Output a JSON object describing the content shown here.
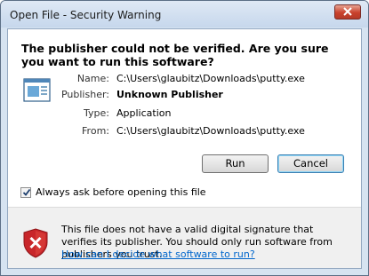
{
  "window": {
    "title": "Open File - Security Warning"
  },
  "headline": "The publisher could not be verified.  Are you sure you want to run this software?",
  "details": [
    {
      "label": "Name:",
      "value": "C:\\Users\\glaubitz\\Downloads\\putty.exe",
      "bold": false
    },
    {
      "label": "Publisher:",
      "value": "Unknown Publisher",
      "bold": true
    },
    {
      "label": "Type:",
      "value": "Application",
      "bold": false
    },
    {
      "label": "From:",
      "value": "C:\\Users\\glaubitz\\Downloads\\putty.exe",
      "bold": false
    }
  ],
  "buttons": {
    "run": "Run",
    "cancel": "Cancel"
  },
  "checkbox": {
    "label": "Always ask before opening this file",
    "checked": true
  },
  "footer": {
    "message": "This file does not have a valid digital signature that verifies its publisher.  You should only run software from publishers you trust.",
    "link": "How can I decide what software to run?"
  },
  "icons": {
    "file": "application-icon",
    "shield": "security-shield-error-icon",
    "close": "close-icon"
  }
}
